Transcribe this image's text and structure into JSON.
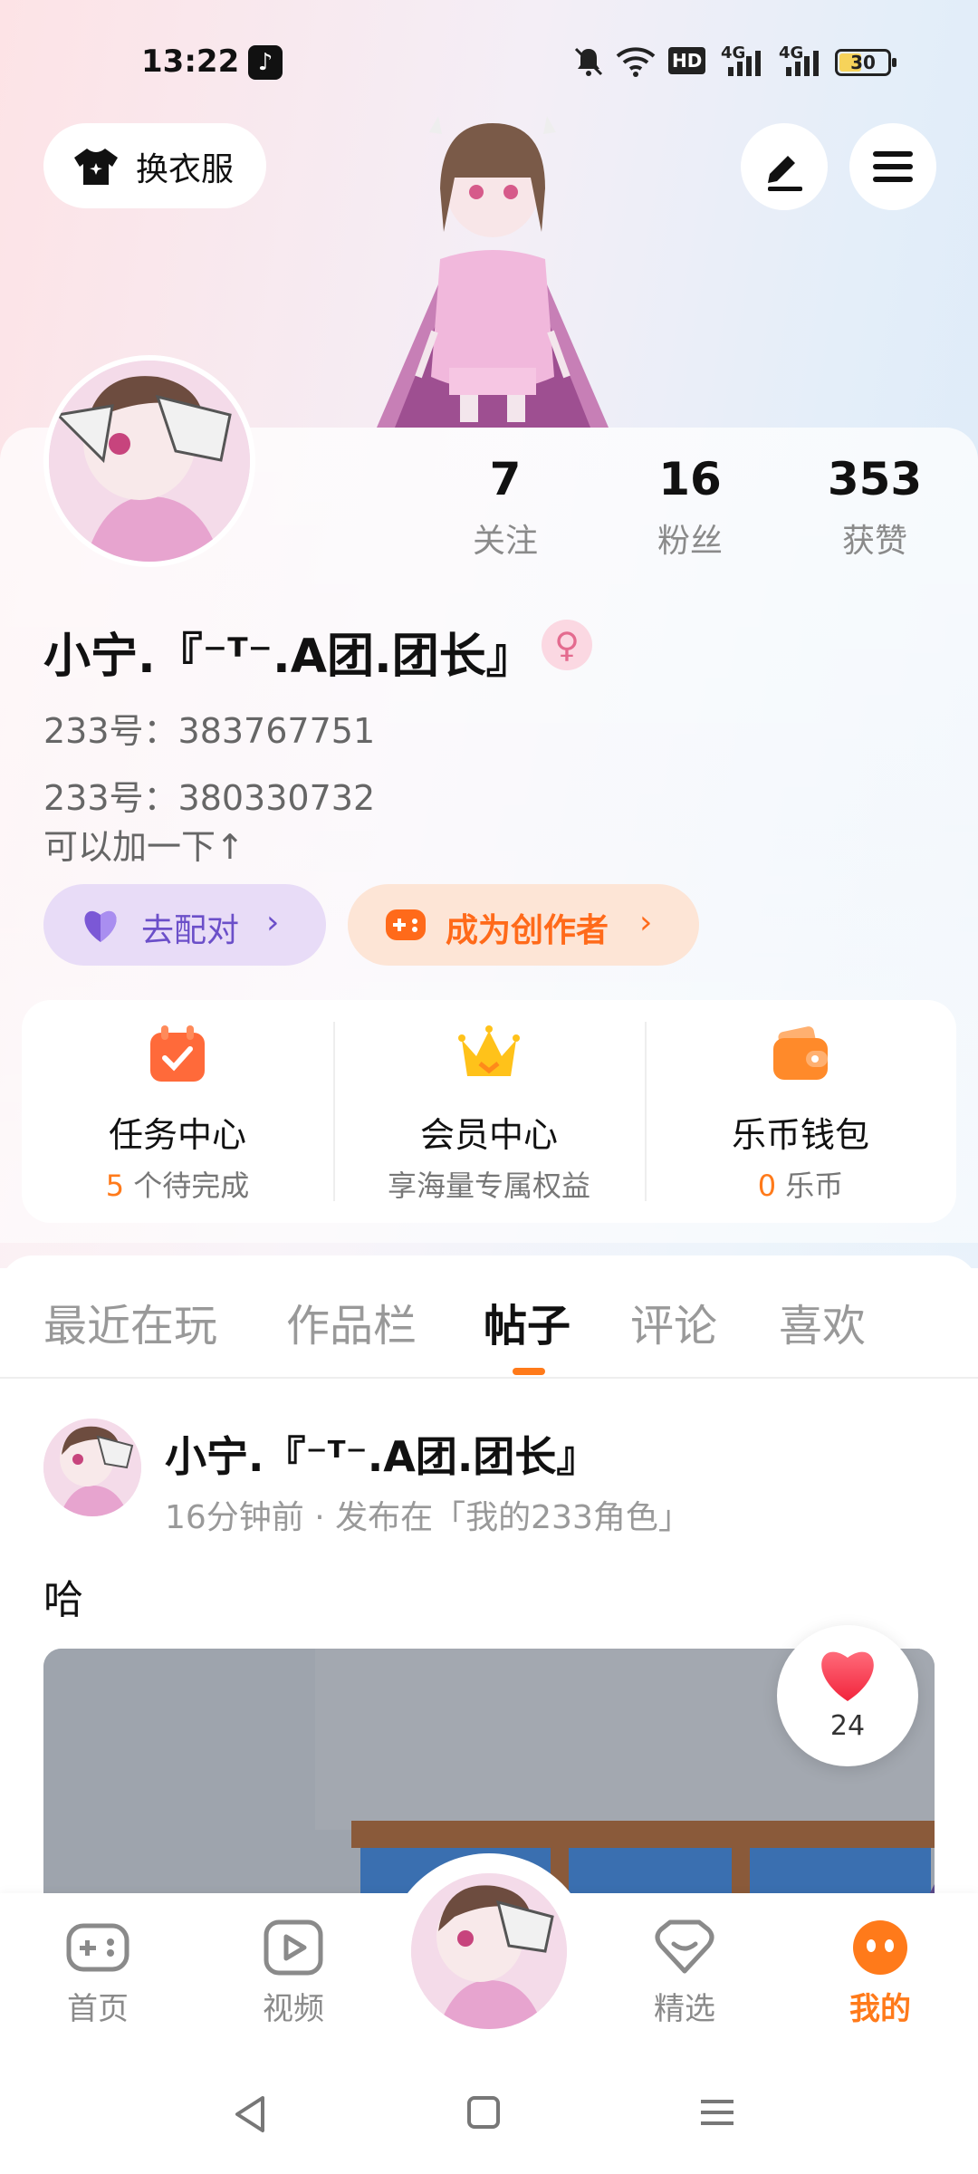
{
  "status_bar": {
    "time": "13:22",
    "battery": "30",
    "hd_label": "HD",
    "network_1": "4G",
    "network_2": "4G"
  },
  "top": {
    "outfit_label": "换衣服"
  },
  "stats": [
    {
      "value": "7",
      "label": "关注"
    },
    {
      "value": "16",
      "label": "粉丝"
    },
    {
      "value": "353",
      "label": "获赞"
    }
  ],
  "profile": {
    "name": "小宁.『⁻ᵀ⁻.A团.团长』",
    "gender_symbol": "♀",
    "bio_lines": [
      "233号：383767751",
      "233号：380330732",
      "可以加一下↑"
    ]
  },
  "actions": {
    "match_label": "去配对",
    "creator_label": "成为创作者"
  },
  "quick": [
    {
      "title": "任务中心",
      "count": "5",
      "suffix": " 个待完成"
    },
    {
      "title": "会员中心",
      "subtitle": "享海量专属权益"
    },
    {
      "title": "乐币钱包",
      "count": "0",
      "suffix": " 乐币"
    }
  ],
  "tabs": [
    "最近在玩",
    "作品栏",
    "帖子",
    "评论",
    "喜欢"
  ],
  "active_tab": "帖子",
  "post": {
    "author": "小宁.『⁻ᵀ⁻.A团.团长』",
    "meta": "16分钟前 · 发布在「我的233角色」",
    "text": "哈",
    "likes": "24"
  },
  "nav": [
    {
      "label": "首页",
      "icon": "gamepad-icon"
    },
    {
      "label": "视频",
      "icon": "play-icon"
    },
    {
      "label": "精选",
      "icon": "heart-chat-icon"
    },
    {
      "label": "我的",
      "icon": "smiley-icon"
    }
  ],
  "colors": {
    "accent": "#ff7a1a",
    "match_bg": "#e8dcf7",
    "match_text": "#6b4fc9",
    "creator_bg": "#fde5d6"
  }
}
